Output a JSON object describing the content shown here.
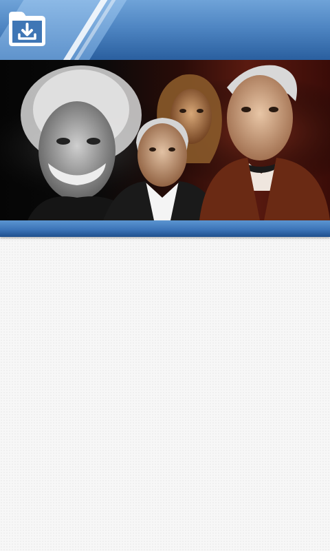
{
  "header": {
    "download_icon": "folder-download-icon"
  },
  "banner": {
    "portraits": [
      "scientist-portrait",
      "scientist-portrait",
      "scientist-portrait",
      "scientist-portrait"
    ]
  },
  "colors": {
    "header_blue": "#4f86c3",
    "header_dark": "#2a5f9f",
    "strip_blue": "#3c74b8",
    "banner_red": "#5a1a10",
    "background": "#f7f7f7"
  }
}
